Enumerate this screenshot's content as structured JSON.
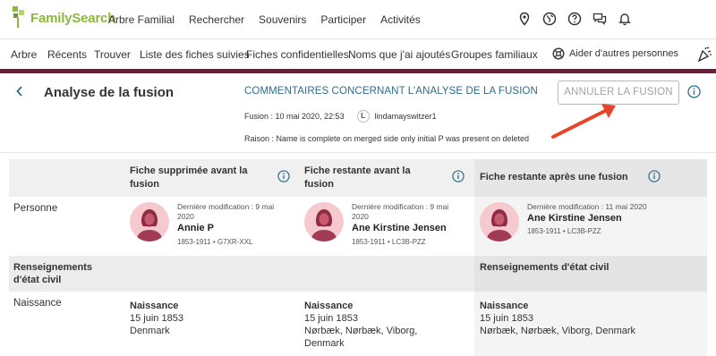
{
  "brand": {
    "logo_text": "FamilySearch",
    "brand_color": "#8cb83f"
  },
  "top_menu": [
    "Arbre Familial",
    "Rechercher",
    "Souvenirs",
    "Participer",
    "Activités"
  ],
  "top_icons": [
    "location-icon",
    "globe-icon",
    "help-icon",
    "chat-icon",
    "bell-icon"
  ],
  "sub_menu": [
    "Arbre",
    "Récents",
    "Trouver",
    "Liste des fiches suivies",
    "Fiches confidentielles",
    "Noms que j'ai ajoutés",
    "Groupes familiaux"
  ],
  "help_link": "Aider d'autres personnes",
  "page": {
    "back_icon": "chevron-left-icon",
    "title": "Analyse de la fusion",
    "comment_link": "COMMENTAIRES CONCERNANT L’ANALYSE DE LA FUSION",
    "fusion_date": "Fusion : 10 mai 2020, 22:53",
    "user_initial": "L",
    "user_name": "lindamayswitzer1",
    "raison": "Raison : Name is complete on merged side only initial P was present on deleted",
    "annuler_button": "ANNULER LA FUSION",
    "accent_color": "#6d1f3d",
    "arrow_color": "#e8442b"
  },
  "table": {
    "columns": [
      {
        "title_line1": "Fiche supprimée avant la",
        "title_line2": "fusion"
      },
      {
        "title_line1": "Fiche restante avant la",
        "title_line2": "fusion"
      },
      {
        "title_line1": "Fiche restante après une fusion",
        "title_line2": ""
      }
    ],
    "row_person_label": "Personne",
    "persons": [
      {
        "modified": "Dernière modification : 9 mai",
        "modified2": "2020",
        "name": "Annie P",
        "ids": "1853-1911 • G7XR-XXL"
      },
      {
        "modified": "Dernière modification : 9 mai",
        "modified2": "2020",
        "name": "Ane Kirstine Jensen",
        "ids": "1853-1911 • LC3B-PZZ"
      },
      {
        "modified": "Dernière modification : 11 mai 2020",
        "modified2": "",
        "name": "Ane Kirstine Jensen",
        "ids": "1853-1911 • LC3B-PZZ"
      }
    ],
    "vital_section_left_1": "Renseignements",
    "vital_section_left_2": "d'état civil",
    "vital_section_right": "Renseignements d'état civil",
    "row_birth_label": "Naissance",
    "births": [
      {
        "title": "Naissance",
        "date": "15 juin 1853",
        "place1": "Denmark",
        "place2": ""
      },
      {
        "title": "Naissance",
        "date": "15 juin 1853",
        "place1": "Nørbæk, Nørbæk, Viborg,",
        "place2": "Denmark"
      },
      {
        "title": "Naissance",
        "date": "15 juin 1853",
        "place1": "Nørbæk, Nørbæk, Viborg, Denmark",
        "place2": ""
      }
    ]
  }
}
